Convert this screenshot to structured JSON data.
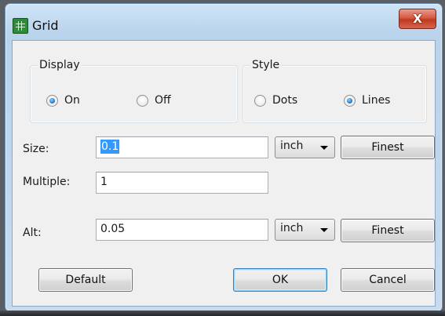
{
  "window": {
    "title": "Grid",
    "close_glyph": "X"
  },
  "display_group": {
    "label": "Display",
    "options": [
      {
        "label": "On",
        "checked": true
      },
      {
        "label": "Off",
        "checked": false
      }
    ]
  },
  "style_group": {
    "label": "Style",
    "options": [
      {
        "label": "Dots",
        "checked": false
      },
      {
        "label": "Lines",
        "checked": true
      }
    ]
  },
  "size": {
    "label": "Size:",
    "value": "0.1",
    "unit": "inch",
    "button": "Finest"
  },
  "multiple": {
    "label": "Multiple:",
    "value": "1"
  },
  "alt": {
    "label": "Alt:",
    "value": "0.05",
    "unit": "inch",
    "button": "Finest"
  },
  "buttons": {
    "default": "Default",
    "ok": "OK",
    "cancel": "Cancel"
  },
  "colors": {
    "selection": "#3399ff",
    "radio_dot": "#1a6fc4",
    "close_button": "#c0381f"
  }
}
